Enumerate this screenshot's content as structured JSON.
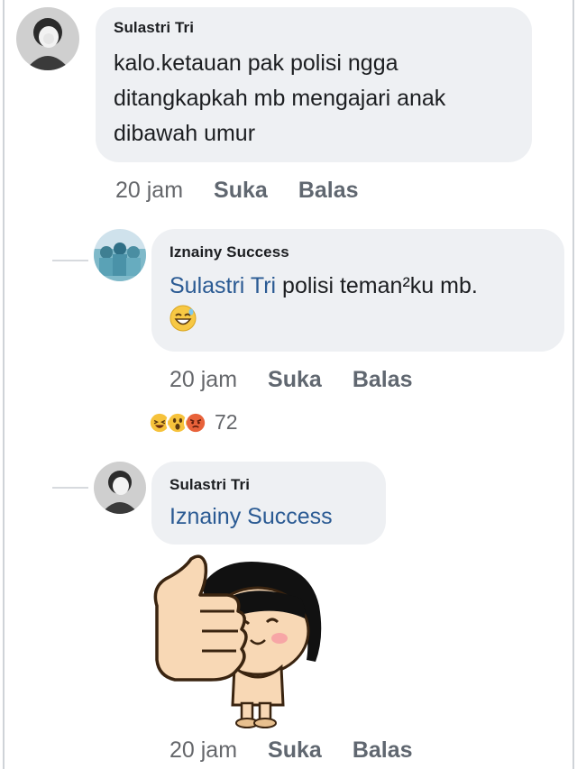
{
  "comments": [
    {
      "author": "Sulastri Tri",
      "text": "kalo.ketauan pak polisi ngga ditangkapkah mb mengajari anak dibawah umur",
      "time": "20 jam",
      "like_label": "Suka",
      "reply_label": "Balas"
    },
    {
      "author": "Iznainy Success",
      "mention": "Sulastri Tri",
      "text": " polisi teman²ku mb.",
      "emoji": "grinning-sweat-emoji",
      "time": "20 jam",
      "like_label": "Suka",
      "reply_label": "Balas",
      "reactions": {
        "icons": [
          "haha-reaction",
          "wow-reaction",
          "angry-reaction"
        ],
        "count": "72"
      }
    },
    {
      "author": "Sulastri Tri",
      "mention": "Iznainy Success",
      "sticker": "thumbs-up-girl-sticker",
      "time": "20 jam",
      "like_label": "Suka",
      "reply_label": "Balas"
    }
  ],
  "colors": {
    "bubble": "#eef0f3",
    "mention": "#2a5a93",
    "meta": "#65676b"
  }
}
